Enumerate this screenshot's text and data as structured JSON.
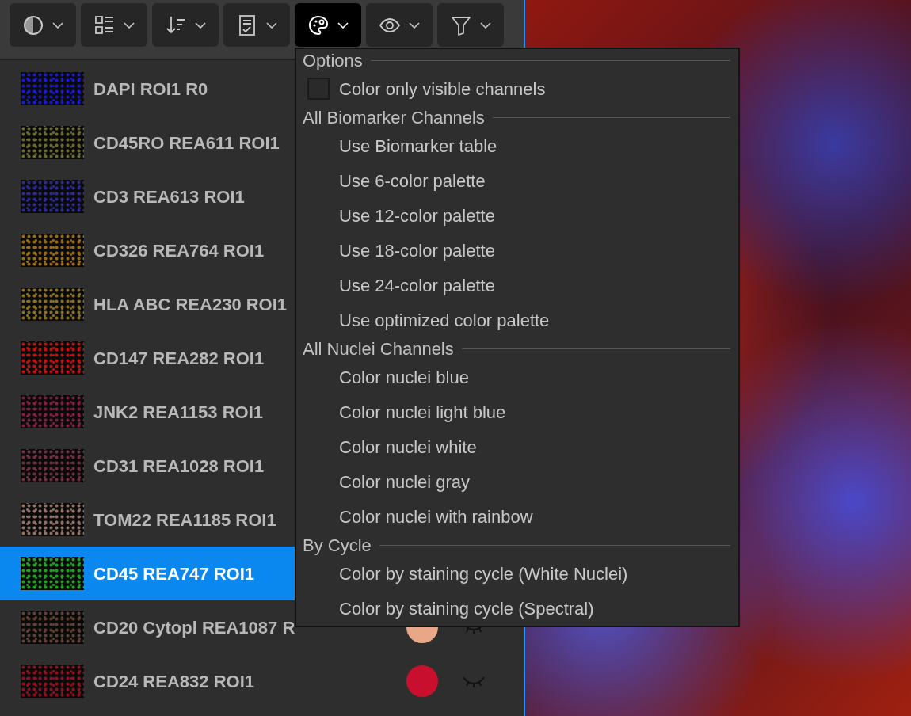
{
  "toolbar": [
    {
      "kind": "contrast",
      "selected": false
    },
    {
      "kind": "layout",
      "selected": false
    },
    {
      "kind": "sort",
      "selected": false
    },
    {
      "kind": "checklist",
      "selected": false
    },
    {
      "kind": "palette",
      "selected": true
    },
    {
      "kind": "eye",
      "selected": false
    },
    {
      "kind": "filter",
      "selected": false
    }
  ],
  "channels": [
    {
      "name": "DAPI ROI1 R0",
      "color": "#1a1ad0",
      "selected": false
    },
    {
      "name": "CD45RO REA611 ROI1",
      "color": "#6a6a30",
      "selected": false
    },
    {
      "name": "CD3 REA613 ROI1",
      "color": "#2a2a90",
      "selected": false
    },
    {
      "name": "CD326 REA764 ROI1",
      "color": "#9a6a10",
      "selected": false
    },
    {
      "name": "HLA ABC REA230 ROI1",
      "color": "#8a7020",
      "selected": false
    },
    {
      "name": "CD147 REA282 ROI1",
      "color": "#c01010",
      "selected": false
    },
    {
      "name": "JNK2 REA1153 ROI1",
      "color": "#802040",
      "selected": false
    },
    {
      "name": "CD31 REA1028 ROI1",
      "color": "#703040",
      "selected": false
    },
    {
      "name": "TOM22 REA1185 ROI1",
      "color": "#907060",
      "selected": false
    },
    {
      "name": "CD45 REA747 ROI1",
      "color": "#20a020",
      "selected": true
    },
    {
      "name": "CD20 Cytopl REA1087 R",
      "color": "#604030",
      "selected": false,
      "swatch": {
        "color": "#e8a888"
      },
      "visible": false
    },
    {
      "name": "CD24 REA832 ROI1",
      "color": "#901020",
      "selected": false,
      "swatch": {
        "color": "#c8102e"
      },
      "visible": false
    }
  ],
  "menu": [
    {
      "kind": "header",
      "label": "Options"
    },
    {
      "kind": "checkbox",
      "label": "Color only visible channels",
      "checked": false
    },
    {
      "kind": "header",
      "label": "All Biomarker Channels"
    },
    {
      "kind": "item",
      "label": "Use Biomarker table"
    },
    {
      "kind": "item",
      "label": "Use 6-color palette"
    },
    {
      "kind": "item",
      "label": "Use 12-color palette"
    },
    {
      "kind": "item",
      "label": "Use 18-color palette"
    },
    {
      "kind": "item",
      "label": "Use 24-color palette"
    },
    {
      "kind": "item",
      "label": "Use optimized color palette"
    },
    {
      "kind": "header",
      "label": "All Nuclei Channels"
    },
    {
      "kind": "item",
      "label": "Color nuclei blue"
    },
    {
      "kind": "item",
      "label": "Color nuclei light blue"
    },
    {
      "kind": "item",
      "label": "Color nuclei white"
    },
    {
      "kind": "item",
      "label": "Color nuclei gray"
    },
    {
      "kind": "item",
      "label": "Color nuclei with rainbow"
    },
    {
      "kind": "header",
      "label": "By Cycle"
    },
    {
      "kind": "item",
      "label": "Color by staining cycle (White Nuclei)"
    },
    {
      "kind": "item",
      "label": "Color by staining cycle (Spectral)"
    }
  ]
}
